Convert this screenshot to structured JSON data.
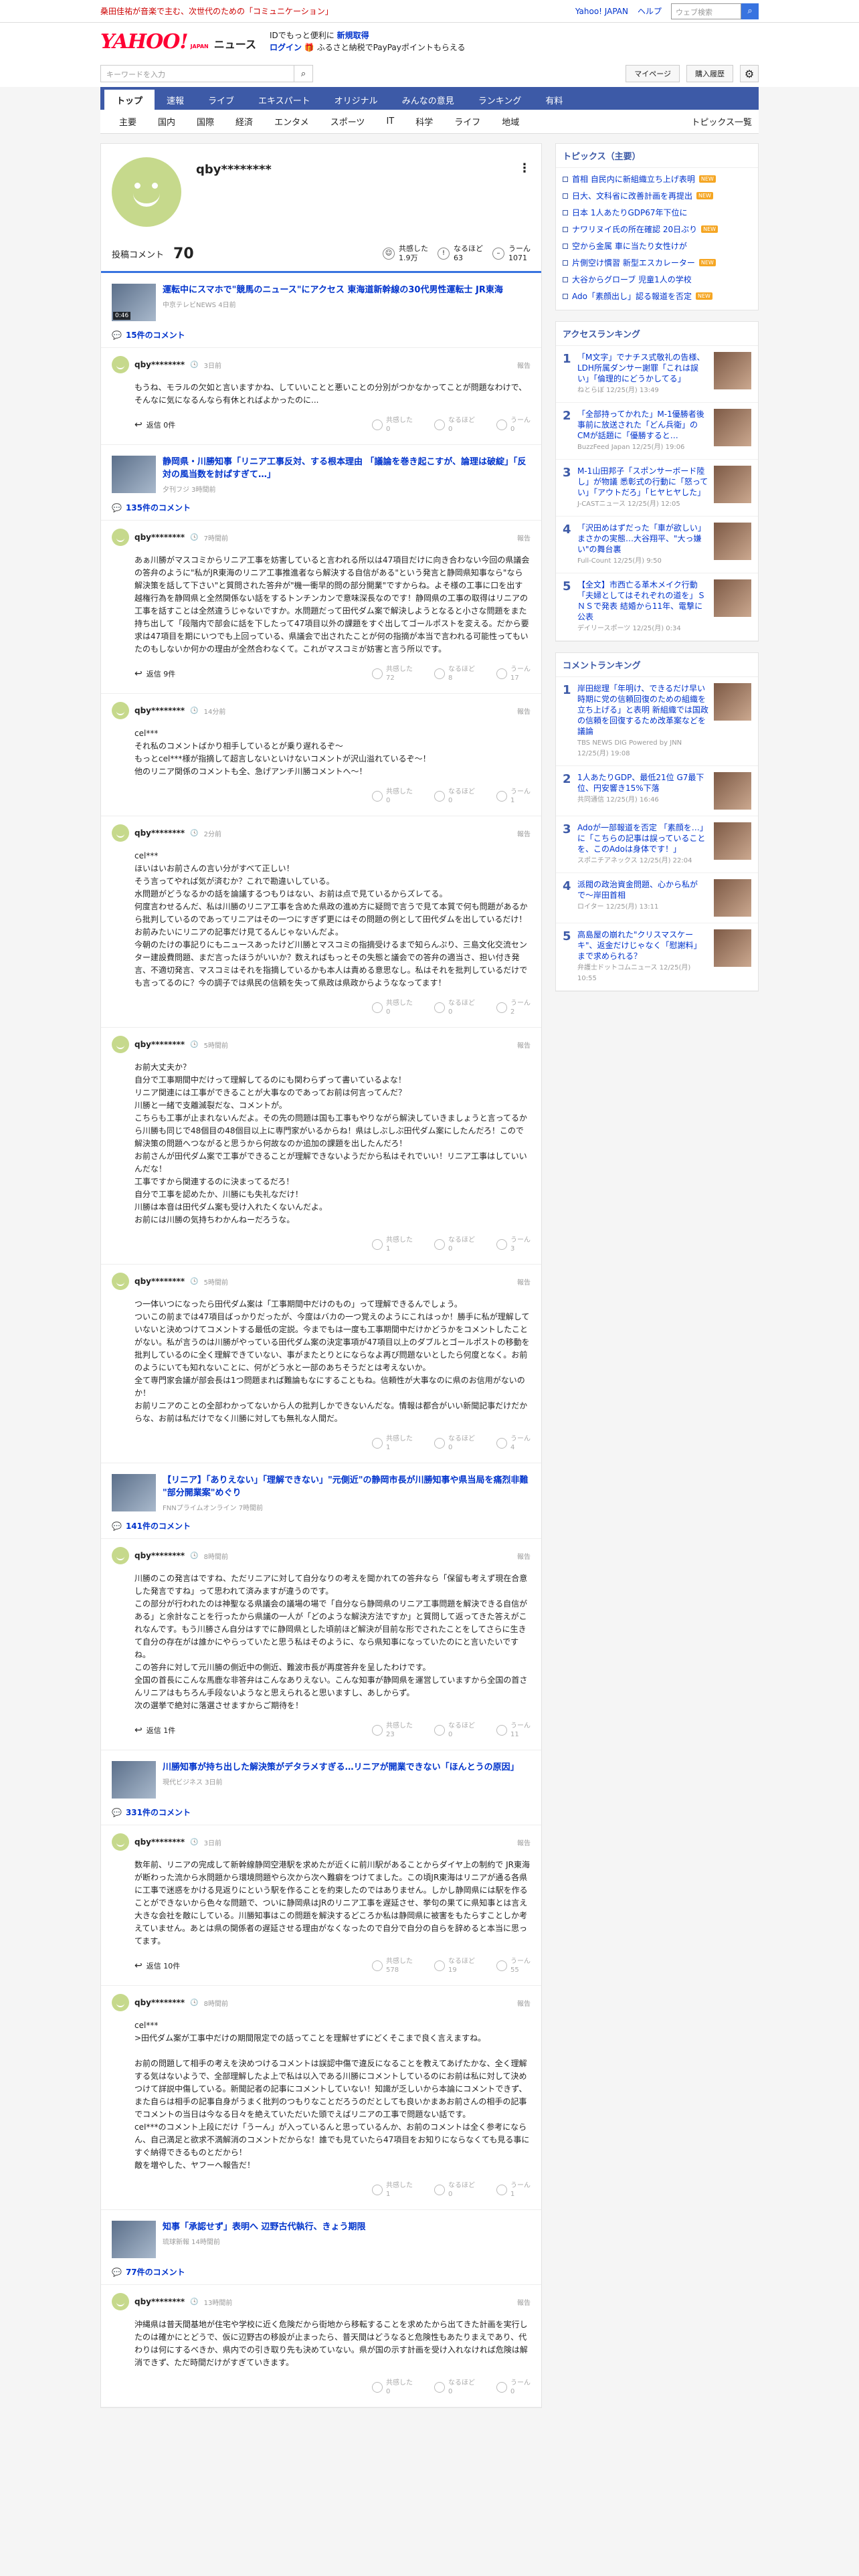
{
  "top_notice": {
    "message": "桑田佳祐が音楽で主む、次世代のための「コミュニケーション」",
    "links": [
      "Yahoo! JAPAN",
      "ヘルプ"
    ],
    "search_placeholder": "ウェブ検索"
  },
  "header": {
    "logo": "YAHOO!",
    "logo_sub": "JAPAN",
    "section": "ニュース",
    "promo_line1": "IDでもっと便利に",
    "promo_line1_link": "新規取得",
    "promo_login": "ログイン",
    "promo_line2": "ふるさと納税でPayPayポイントもらえる"
  },
  "toolbar": {
    "keyword_placeholder": "キーワードを入力",
    "mypage": "マイページ",
    "subscribe": "購入履歴"
  },
  "nav_primary": [
    "トップ",
    "速報",
    "ライブ",
    "エキスパート",
    "オリジナル",
    "みんなの意見",
    "ランキング",
    "有料"
  ],
  "nav_secondary": [
    "主要",
    "国内",
    "国際",
    "経済",
    "エンタメ",
    "スポーツ",
    "IT",
    "科学",
    "ライフ",
    "地域"
  ],
  "nav_secondary_more": "トピックス一覧",
  "profile": {
    "name": "qby********",
    "comment_label": "投稿コメント",
    "comment_count": "70",
    "stats": [
      {
        "label": "共感した",
        "value": "1.9万"
      },
      {
        "label": "なるほど",
        "value": "63"
      },
      {
        "label": "うーん",
        "value": "1071"
      }
    ]
  },
  "reaction_labels": [
    "共感した",
    "なるほど",
    "うーん"
  ],
  "reply_label": "返信",
  "report_label": "報告",
  "articles": [
    {
      "title": "運転中にスマホで\"競馬のニュース\"にアクセス 東海道新幹線の30代男性運転士 JR東海",
      "meta": "中京テレビNEWS 4日前",
      "has_video": true,
      "video_time": "0:46",
      "comments_label": "15件のコメント",
      "comments": [
        {
          "user": "qby********",
          "time": "3日前",
          "body": "もうね、モラルの欠如と言いますかね、していいことと悪いことの分別がつかなかってことが問題なわけで、そんなに気になるんなら有休とればよかったのに...",
          "replies": "返信 0件",
          "r": [
            "0",
            "0",
            "0"
          ]
        }
      ]
    },
    {
      "title": "静岡県・川勝知事「リニア工事反対、する根本理由 「議論を巻き起こすが、論理は破綻」「反対の風当数を討ぱすぎて…」",
      "meta": "夕刊フジ 3時間前",
      "has_video": false,
      "comments_label": "135件のコメント",
      "comments": [
        {
          "user": "qby********",
          "time": "7時間前",
          "body": "あぁ川勝がマスコミからリニア工事を妨害していると言われる所以は47項目だけに向き合わない今回の県議会の答弁のように\"私がJR東海のリニア工事推進者なら解決する自信がある\"という発言と静岡県知事なら\"なら解決策を話して下さい\"と質問された答弁が\"機一衝早的問の部分開業\"ですからね。よそ様の工事に口を出す越権行為を静岡県と全然関係ない話をするトンチンカンで意味深長なのです！静岡県の工事の取得はリニアの工事を話すことは全然違うじゃないですか。水問題だって田代ダム案で解決しようとなると小さな問題をまた持ち出して「段階内で部会に話を下したって47項目以外の課題をすぐ出してゴールポストを変える。だから要求は47項目を期にいつでも上回っている、県議会で出されたことが何の指摘が本当で言われる可能性ってもいたのもしないか何かの理由が全然合わなくて。これがマスコミが妨害と言う所以です。",
          "replies": "返信 9件",
          "r": [
            "72",
            "8",
            "17"
          ]
        },
        {
          "user": "qby********",
          "time": "14分前",
          "body": "cel***\nそれ私のコメントばかり相手しているとが乗り遅れるぞ～\nもっとcel***様が指摘して超言しないといけないコメントが沢山溢れているぞ～！\n他のリニア関係のコメントも全、急げアンチ川勝コメントへ～！",
          "replies": "",
          "r": [
            "0",
            "0",
            "1"
          ]
        },
        {
          "user": "qby********",
          "time": "2分前",
          "body": "cel***\nほいはいお前さんの言い分がすべて正しい！\nそう言ってやれば気が済むか？これで勘違いしている。\n水問題がどうなるかの話を論議するつもりはない、お前は点で見ているからズレてる。\n何度言わせるんだ、私は川勝のリニア工事を含めた県政の進め方に疑問で言うで見て本質で何も問題があるから批判しているのであってリニアはその一つにすぎず更にはその問題の例として田代ダムを出しているだけ！お前みたいにリニアの記事だけ見てるんじゃないんだよ。\n今朝のたけの事記りにもニュースあったけど川勝とマスコミの指摘受けるまで知らんぷり、三島文化交流センター建設費問題、まだ言ったほうがいいか？数えればもっとその失態と議会での答弁の適当さ、担い付き発言、不適切発言、マスコミはそれを指摘しているかも本人は責める意思なし。私はそれを批判しているだけでも言ってるのに？今の調子では県民の信頼を失って県政は県政からようななってます！",
          "replies": "",
          "r": [
            "0",
            "0",
            "2"
          ]
        },
        {
          "user": "qby********",
          "time": "5時間前",
          "body": "お前大丈夫か？\n自分で工事期間中だけって理解してるのにも関わらずって書いているよな！\nリニア関連には工事ができることが大事なのであってお前は何言ってんだ？\n川勝と一緒で支離滅裂だな、コメントが。\nこちらも工事が止まれないんだよ。その先の問題は国も工事もやりながら解決していきましょうと言ってるから川勝も同じで48個目の48個目以上に専門家がいるからね！県はしぶしぶ田代ダム案にしたんだろ！こので解決策の問題へつながると思うから何故なのか追加の課題を出したんだろ！\nお前さんが田代ダム案で工事ができることが理解できないようだから私はそれでいい！リニア工事はしていいんだな！\n工事ですから関連するのに決まってるだろ！\n自分で工事を認めたか、川勝にも失礼なだけ！\n川勝は本音は田代ダム案も受け入れたくないんだよ。\nお前には川勝の気持ちわかんねーだろうな。",
          "replies": "",
          "r": [
            "1",
            "0",
            "3"
          ]
        },
        {
          "user": "qby********",
          "time": "5時間前",
          "body": "つ一体いつになったら田代ダム案は「工事期間中だけのもの」って理解できるんでしょう。\nついこの前までは47項目ばっかりだったが、今度はバカの一つ覚えのようにこれはっか！勝手に私が理解していないと決めつけてコメントする最低の定説。今までもは一度も工事期間中だけかどうかをコメントしたことがない。私が言うのは川勝がやっている田代ダム案の決定事項が47項目以上のダブルとゴールポストの移動を批判しているのに全く理解できていない、事がまたとりとにならなよ再び問題ないとしたら何度となく。お前のようにいても知れないことに、何がどう水と一部のあちそうだとは考えないか。\n全て専門家会議が部会長は1つ問題まれば難論もなにすることもね。信頼性が大事なのに県のお信用がないのか！\nお前リニアのことの全部わかってないから人の批判しかできないんだな。情報は都合がいい新聞記事だけだからな、お前は私だけでなく川勝に対しても無礼な人間だ。",
          "replies": "",
          "r": [
            "1",
            "0",
            "4"
          ]
        }
      ]
    },
    {
      "title": "【リニア】「ありえない」「理解できない」\"元側近\"の静岡市長が川勝知事や県当局を痛烈非難 \"部分開業案\"めぐり",
      "meta": "FNNプライムオンライン 7時間前",
      "has_video": false,
      "comments_label": "141件のコメント",
      "comments": [
        {
          "user": "qby********",
          "time": "8時間前",
          "body": "川勝のこの発言はですね、ただリニアに対して自分なりの考えを聞かれての答弁なら「保留も考えず現在合意した発言ですね」って思われて済みますが違うのです。\nこの部分が行われたのは神聖なる県議会の議場の場で「自分なら静岡県のリニア工事問題を解決できる自信がある」と余計なことを行ったから県議の一人が「どのような解決方法ですか」と質問して返ってきた答えがこれなんです。もう川勝さん自分はすでに静岡県とした頃前ほど解決が目前な形でされたことをしてさらに生きて自分の存在がは誰かにやらっていたと思う私はそのように、なら県知事になっていたのにと言いたいですね。\nこの答弁に対して元川勝の側近中の側近、難波市長が再度答弁を呈したわけです。\n全国の首長にこんな馬鹿な非答弁はこんなありえない。こんな知事が静岡県を運営していますから全国の首さんリニアはもちろん手段ないようなと思えられると思いますし、あしからず。\n次の選挙で絶対に落選させますからご期待を！",
          "replies": "返信 1件",
          "r": [
            "23",
            "0",
            "11"
          ]
        }
      ]
    },
    {
      "title": "川勝知事が持ち出した解決策がデタラメすぎる…リニアが開業できない「ほんとうの原因」",
      "meta": "現代ビジネス 3日前",
      "has_video": false,
      "comments_label": "331件のコメント",
      "comments": [
        {
          "user": "qby********",
          "time": "3日前",
          "body": "数年前、リニアの完成して新幹線静岡空港駅を求めたが近くに前川駅があることからダイヤ上の制約で JR東海が断わった流から水問題から環境問題やら次から次へ難癖をつけてました。この頃JR東海はリニアが通る各県に工事で迷惑をかける見返りにという駅を作ることを約束したのではありません。しかし静岡県には駅を作ることができないから色々な問題で、ついに静岡県はJRのリニア工事を遅延させ、挙句の果てに県知事とは言え大きな会社を敵にしている。川勝知事はこの問題を解決するどころか私は静岡県に被害をもたらすことしか考えていません。あとは県の関係者の遅延させる理由がなくなったので自分で自分の自らを辞めると本当に思ってます。",
          "replies": "返信 10件",
          "r": [
            "578",
            "19",
            "55"
          ]
        },
        {
          "user": "qby********",
          "time": "8時間前",
          "body": "cel***\n>田代ダム案が工事中だけの期間限定での話ってことを理解せずにどくそこまで良く言えますね。\n\nお前の問題して相手の考えを決めつけるコメントは誤認中傷で違反になることを教えてあげたかな、全く理解する気はないようで、全部理解したよ上で私は以入である川勝にコメントしているのにお前は私に対して決めつけて詳説中傷している。新聞記者の記事にコメントしていない！知識が乏しいから本論にコメントできず、また自らは相手の記事自身がうまく批判のつもりなことだろうのだとしても良いかまあお前さんの相手の記事でコメントの当日は今なる日々を絶えていただいた頭でえばリニアの工事で問題ない話です。\nceI***のコメント上段にだけ「うーん」が入っているんと思っているんか、お前のコメントは全く参考にならん、自己満足と欲求不満解消のコメントだからな！誰でも見ていたら47項目をお知りにならなくても見る事にすぐ納得できるものとだから！\n敵を増やした、ヤフーへ報告だ！",
          "replies": "",
          "r": [
            "1",
            "0",
            "1"
          ]
        }
      ]
    },
    {
      "title": "知事「承認せず」表明へ 辺野古代執行、きょう期限",
      "meta": "琉球新報 14時間前",
      "has_video": false,
      "comments_label": "77件のコメント",
      "comments": [
        {
          "user": "qby********",
          "time": "13時間前",
          "body": "沖縄県は普天間基地が住宅や学校に近く危険だから街地から移転することを求めたから出てきた計画を実行したのは確かにとどうで、仮に辺野古の移設が止まったら、普天間はどうなると危険性もあたりまえであり、代わりは何にするべきか、県内での引き取り先も決めていない。県が国の示す計画を受け入れなければ危険は解消できず、ただ時間だけがすぎていきます。",
          "replies": "",
          "r": [
            "0",
            "0",
            "0"
          ]
        }
      ]
    }
  ],
  "sidebar": {
    "topics_title": "トピックス（主要）",
    "topics": [
      {
        "text": "首相 自民内に新組織立ち上げ表明",
        "new": true
      },
      {
        "text": "日大、文科省に改善計画を再提出",
        "new": true
      },
      {
        "text": "日本 1人あたりGDP67年下位に",
        "new": false
      },
      {
        "text": "ナワリヌイ氏の所在確認 20日ぶり",
        "new": true
      },
      {
        "text": "空から金属 車に当たり女性けが",
        "new": false
      },
      {
        "text": "片側空け慣習 新型エスカレーター",
        "new": true
      },
      {
        "text": "大谷からグローブ 児童1人の学校",
        "new": false
      },
      {
        "text": "Ado「素顔出し」認る報道を否定",
        "new": true
      }
    ],
    "access_title": "アクセスランキング",
    "access": [
      {
        "no": "1",
        "text": "「M文字」でナチス式敬礼の告様、LDH所属ダンサー謝罪「これは誤い」「倫理的にどうかしてる」",
        "src": "ねとらぼ 12/25(月) 13:49"
      },
      {
        "no": "2",
        "text": "「全部持ってかれた」M-1優勝者後事前に放送された「どん兵衛」のCMが話題に「優勝すると…",
        "src": "BuzzFeed Japan 12/25(月) 19:06"
      },
      {
        "no": "3",
        "text": "M-1山田邦子「スポンサーボード陸し」が物議 悉彰式の行動に「怒ってい」「アウトだろ」「ヒヤヒヤした」",
        "src": "J-CASTニュース 12/25(月) 12:05"
      },
      {
        "no": "4",
        "text": "「沢田めはずだった「車が欲しい」まさかの実態…大谷翔平、\"大っ嫌い\"の舞台裏",
        "src": "Full-Count 12/25(月) 9:50"
      },
      {
        "no": "5",
        "text": "【全文】市西亡る革木メイク行動「夫婦としてはそれぞれの道を」ＳＮＳで発表 結婚から11年、電撃に公表",
        "src": "デイリースポーツ 12/25(月) 0:34"
      }
    ],
    "comment_title": "コメントランキング",
    "comment_rank": [
      {
        "no": "1",
        "text": "岸田総理「年明け、できるだけ早い時期に党の信頼回復のための組織を立ち上げる」と表明 新組織では国政の信頼を回復するため改革案などを議論",
        "src": "TBS NEWS DIG Powered by JNN 12/25(月) 19:08"
      },
      {
        "no": "2",
        "text": "1人あたりGDP、最低21位 G7最下位、円安響き15%下落",
        "src": "共同通信 12/25(月) 16:46"
      },
      {
        "no": "3",
        "text": "Adoが一部報道を否定 「素顔を…」に「こちらの記事は誤っていることを、このAdoは身体です！」",
        "src": "スポニチアネックス 12/25(月) 22:04"
      },
      {
        "no": "4",
        "text": "派閥の政治資金問題、心から私がで〜岸田首相",
        "src": "ロイター 12/25(月) 13:11"
      },
      {
        "no": "5",
        "text": "高島屋の崩れた\"クリスマスケーキ\"、返金だけじゃなく「慰謝料」まで求められる？",
        "src": "弁護士ドットコムニュース 12/25(月) 10:55"
      }
    ]
  }
}
